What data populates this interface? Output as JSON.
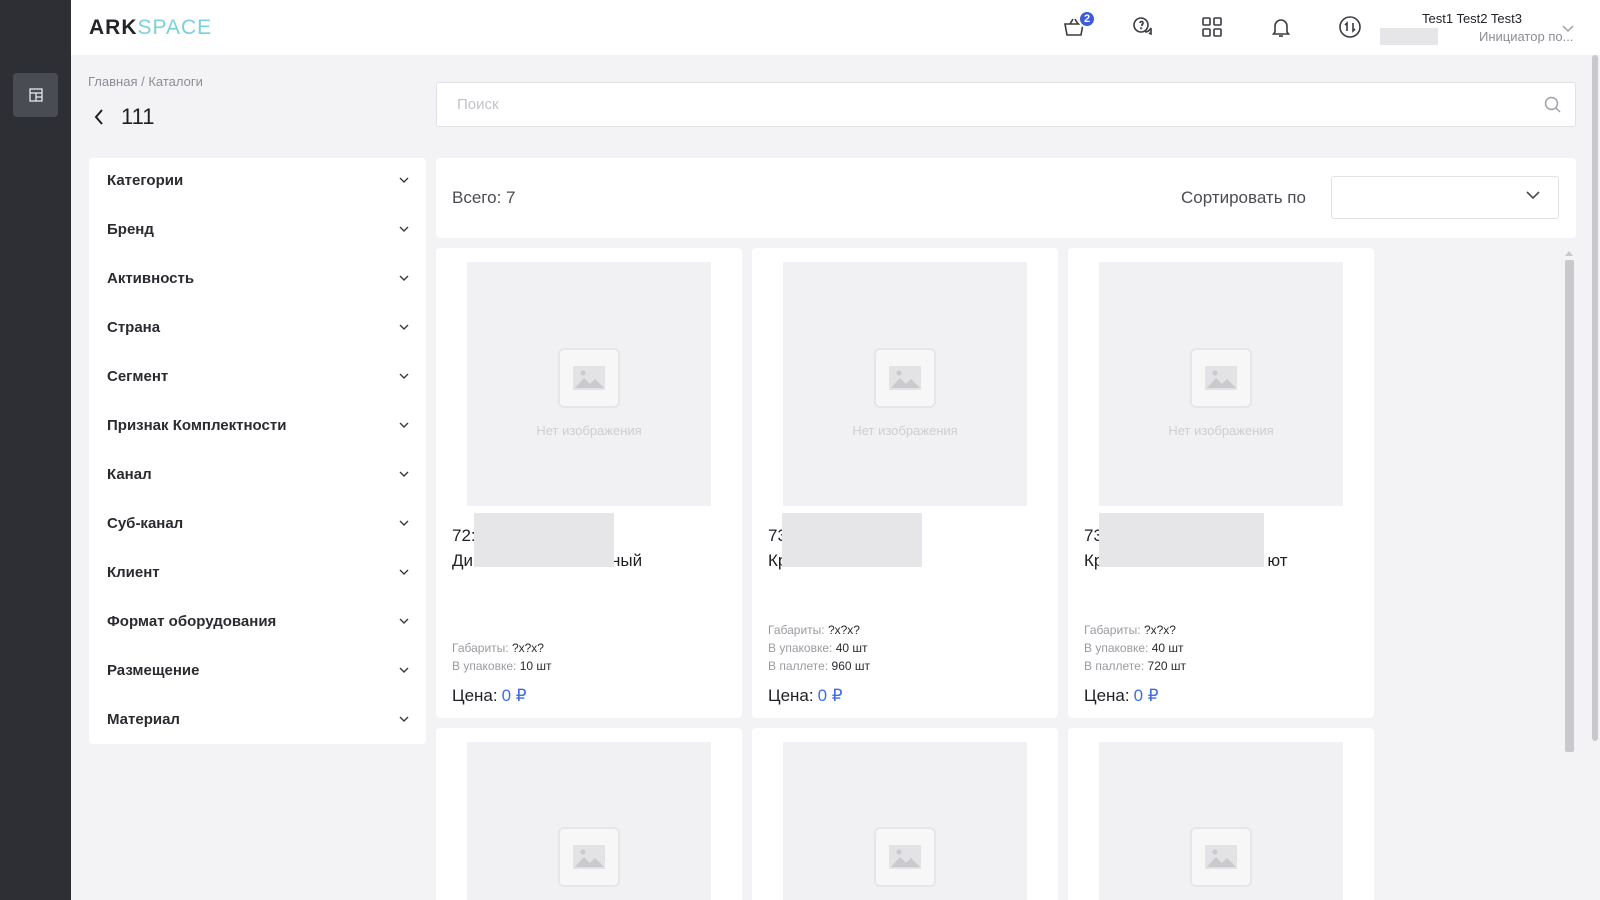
{
  "app": {
    "logo_bold": "ARK",
    "logo_light": "SPACE"
  },
  "header": {
    "cart_badge": "2",
    "user_name": "Test1 Test2 Test3",
    "user_role": "Инициатор по..."
  },
  "breadcrumb": {
    "home": "Главная",
    "separator": "/",
    "current": "Каталоги"
  },
  "page": {
    "title": "111"
  },
  "search": {
    "placeholder": "Поиск"
  },
  "filters": [
    {
      "label": "Категории"
    },
    {
      "label": "Бренд"
    },
    {
      "label": "Активность"
    },
    {
      "label": "Страна"
    },
    {
      "label": "Сегмент"
    },
    {
      "label": "Признак Комплектности"
    },
    {
      "label": "Канал"
    },
    {
      "label": "Суб-канал"
    },
    {
      "label": "Клиент"
    },
    {
      "label": "Формат оборудования"
    },
    {
      "label": "Размещение"
    },
    {
      "label": "Материал"
    }
  ],
  "toolbar": {
    "total": "Всего: 7",
    "sort_label": "Сортировать по",
    "sort_value": ""
  },
  "labels": {
    "no_image": "Нет изображения",
    "dims": "Габариты:",
    "pack": "В упаковке:",
    "pallet": "В паллете:",
    "price": "Цена:"
  },
  "products": [
    {
      "name_line1": "72:",
      "name_line2": "Ди",
      "name_tail": "ный",
      "dims": "?x?x?",
      "pack": "10 шт",
      "pallet": "",
      "price": "0 ₽"
    },
    {
      "name_line1": "73",
      "name_line2": "Кр",
      "name_tail": "",
      "dims": "?x?x?",
      "pack": "40 шт",
      "pallet": "960 шт",
      "price": "0 ₽"
    },
    {
      "name_line1": "73",
      "name_line2": "Кр",
      "name_tail": "ют",
      "dims": "?x?x?",
      "pack": "40 шт",
      "pallet": "720 шт",
      "price": "0 ₽"
    }
  ],
  "colors": {
    "accent": "#3d5bd9",
    "price": "#3d6fe0",
    "rail": "#2e2f35"
  },
  "icons": [
    "catalog-icon",
    "cart-icon",
    "chat-icon",
    "apps-grid-icon",
    "bell-icon",
    "sync-icon",
    "chevron-down-icon",
    "search-icon",
    "back-arrow-icon",
    "image-placeholder-icon"
  ]
}
